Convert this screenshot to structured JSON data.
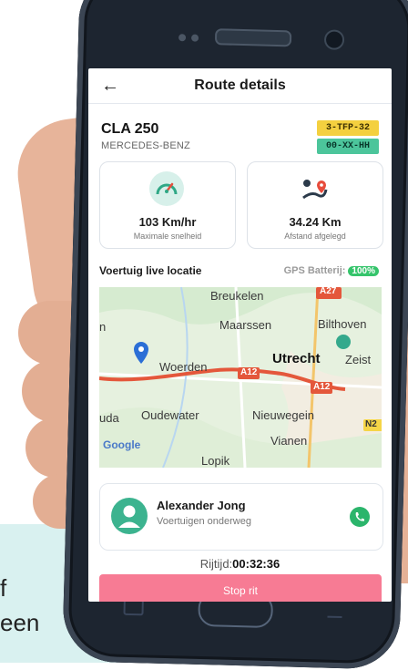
{
  "background": {
    "line1": "f",
    "line2": "een"
  },
  "header": {
    "back_icon": "arrow-left-icon",
    "title": "Route details"
  },
  "vehicle": {
    "model": "CLA 250",
    "brand": "MERCEDES-BENZ",
    "plates": [
      "3-TFP-32",
      "00-XX-HH"
    ],
    "plate_colors": [
      "#f4d03f",
      "#4cc59b"
    ]
  },
  "stats": [
    {
      "icon": "speedometer-icon",
      "value": "103 Km/hr",
      "label": "Maximale snelheid"
    },
    {
      "icon": "route-distance-icon",
      "value": "34.24 Km",
      "label": "Afstand afgelegd"
    }
  ],
  "live": {
    "title": "Voertuig live locatie",
    "gps_label": "GPS Batterij:",
    "gps_value": "100%"
  },
  "map": {
    "places": [
      "Breukelen",
      "Maarssen",
      "Bilthoven",
      "Utrecht",
      "Zeist",
      "Woerden",
      "Oudewater",
      "Nieuwegein",
      "Vianen",
      "Lopik",
      "n",
      "uda"
    ],
    "roads": [
      "A27",
      "A12",
      "A12",
      "N2"
    ],
    "logo": "Google"
  },
  "driver": {
    "name": "Alexander Jong",
    "status": "Voertuigen onderweg",
    "call_icon": "phone-call-icon"
  },
  "ride": {
    "label": "Rijtijd:",
    "time": "00:32:36"
  },
  "actions": {
    "stop_label": "Stop rit"
  },
  "colors": {
    "accent": "#3cb38f",
    "stop_button": "#f77b94",
    "gps_badge": "#35c46b",
    "route": "#e4573b"
  }
}
